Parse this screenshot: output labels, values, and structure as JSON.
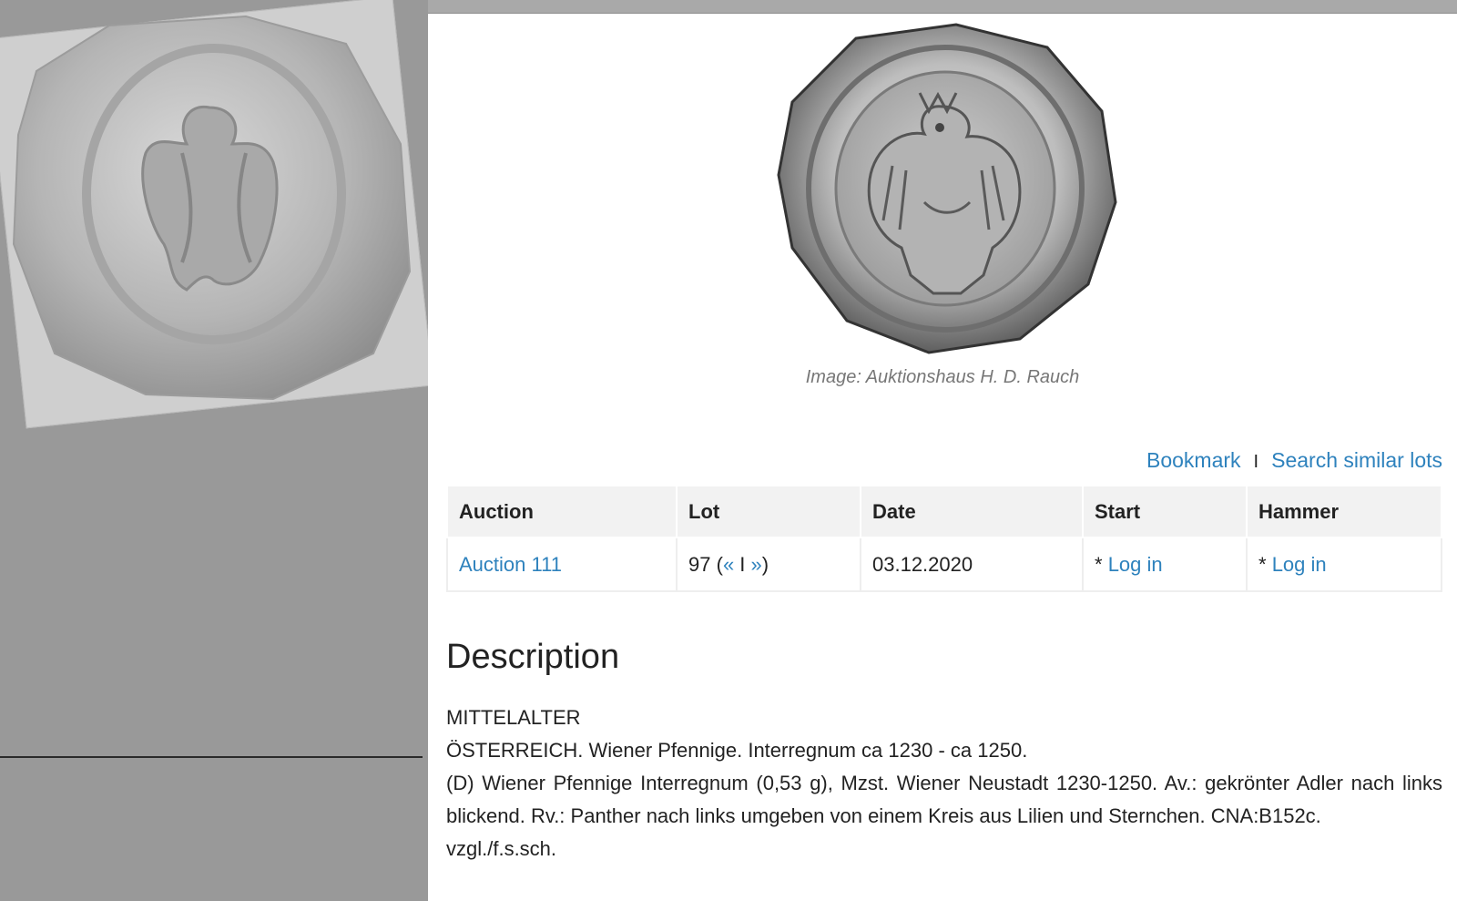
{
  "left_panel": {
    "photo_alt": "Hand-held photo of a medieval silver pfennig with an eagle"
  },
  "coin": {
    "caption": "Image: Auktionshaus H. D. Rauch"
  },
  "actions": {
    "bookmark": "Bookmark",
    "separator": "I",
    "search_similar": "Search similar lots"
  },
  "table": {
    "headers": [
      "Auction",
      "Lot",
      "Date",
      "Start",
      "Hammer"
    ],
    "row": {
      "auction": "Auction 111",
      "lot_number": "97",
      "lot_open": "(",
      "lot_prev": "«",
      "lot_sep": " I ",
      "lot_next": "»",
      "lot_close": ")",
      "date": "03.12.2020",
      "start_prefix": "* ",
      "start_link": "Log in",
      "hammer_prefix": "* ",
      "hammer_link": "Log in"
    }
  },
  "description": {
    "title": "Description",
    "lines": [
      "MITTELALTER",
      "ÖSTERREICH. Wiener Pfennige. Interregnum ca 1230 - ca 1250.",
      "(D) Wiener Pfennige Interregnum (0,53 g), Mzst. Wiener Neustadt 1230-1250. Av.: gekrönter Adler nach links blickend. Rv.: Panther nach links umgeben von einem Kreis aus Lilien und Sternchen. CNA:B152c.",
      "vzgl./f.s.sch."
    ]
  },
  "colors": {
    "link": "#2e82bd",
    "panel_grey": "#999999",
    "header_bg": "#f2f2f2"
  }
}
